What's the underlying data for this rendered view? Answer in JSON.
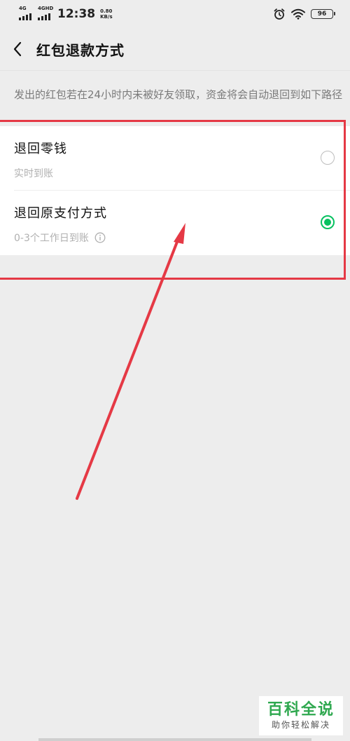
{
  "status_bar": {
    "network_1": "4G",
    "network_2": "4GHD",
    "time": "12:38",
    "speed_value": "0.80",
    "speed_unit": "KB/s",
    "battery": "96",
    "icons": [
      "signal-icon",
      "alarm-icon",
      "wifi-icon",
      "battery-icon"
    ]
  },
  "header": {
    "title": "红包退款方式",
    "back_icon": "back-arrow-icon"
  },
  "description": "发出的红包若在24小时内未被好友领取，资金将会自动退回到如下路径",
  "options": [
    {
      "title": "退回零钱",
      "subtitle": "实时到账",
      "selected": false
    },
    {
      "title": "退回原支付方式",
      "subtitle": "0-3个工作日到账",
      "selected": true,
      "info_icon": "info-icon"
    }
  ],
  "colors": {
    "background": "#ededed",
    "card": "#ffffff",
    "accent_green": "#07c160",
    "annotation_red": "#e53945"
  },
  "watermark": {
    "main": "百科全说",
    "sub": "助你轻松解决"
  }
}
